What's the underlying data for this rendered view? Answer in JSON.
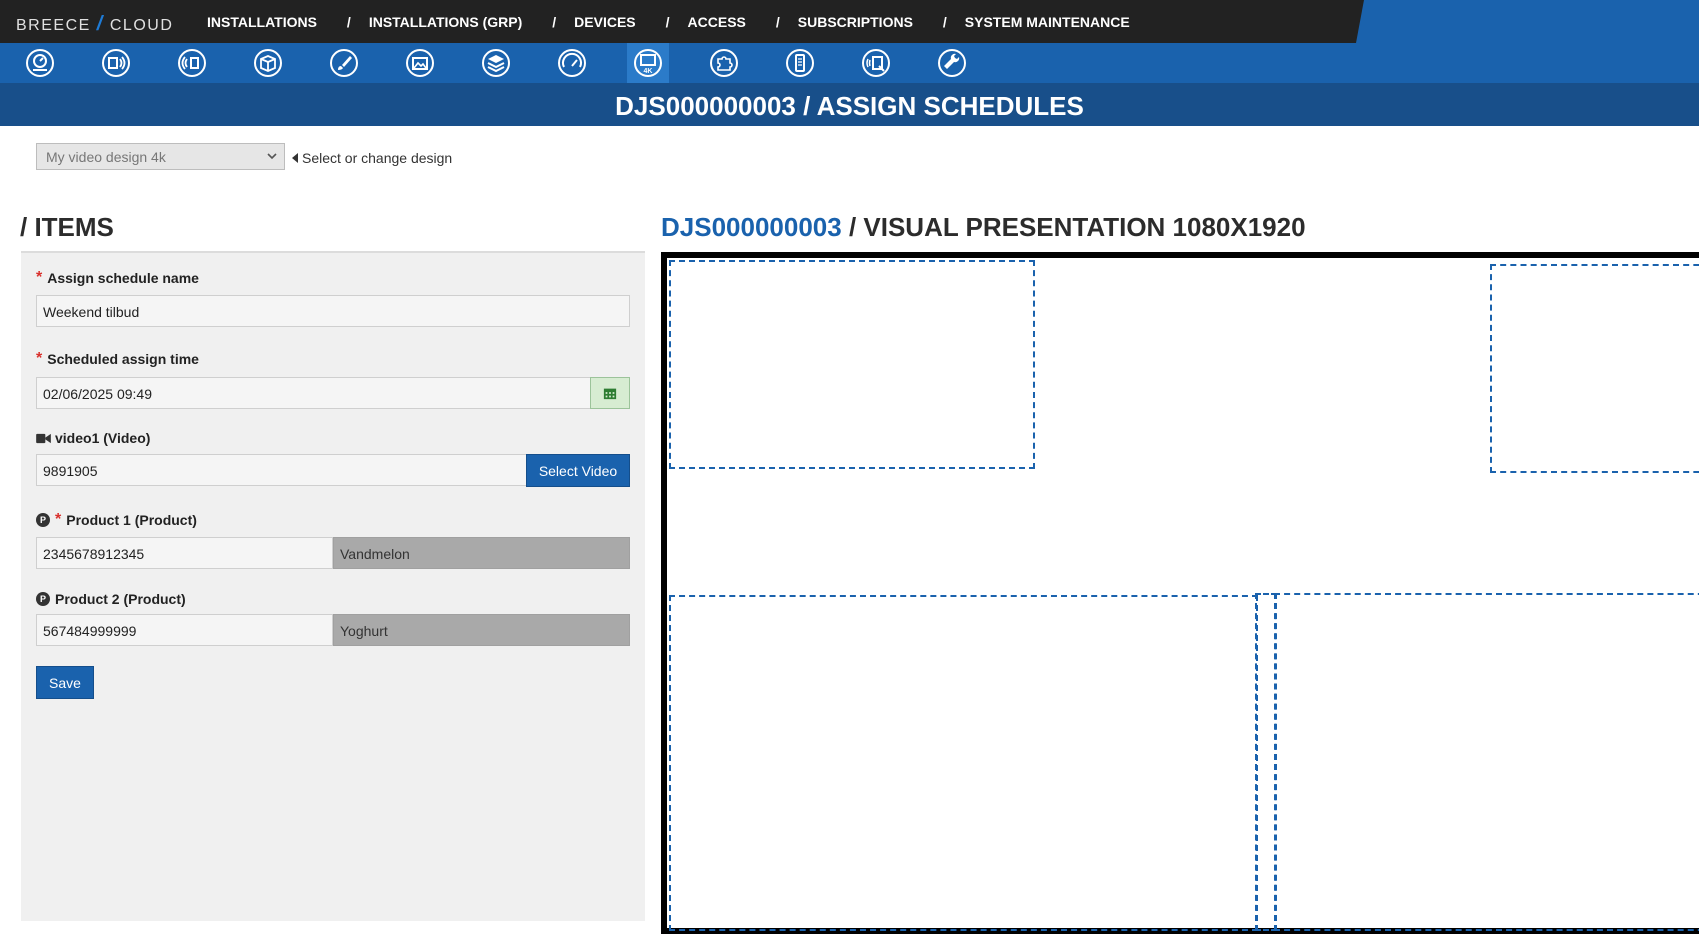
{
  "logo": {
    "left": "BREECE",
    "slash": "/",
    "right": "CLOUD"
  },
  "topnav": {
    "items": [
      "INSTALLATIONS",
      "INSTALLATIONS (GRP)",
      "DEVICES",
      "ACCESS",
      "SUBSCRIPTIONS",
      "SYSTEM MAINTENANCE"
    ],
    "separator": "/"
  },
  "page_title": "DJS000000003 / ASSIGN SCHEDULES",
  "design": {
    "selected": "My video design 4k",
    "hint": "Select or change design"
  },
  "items": {
    "heading": "/ ITEMS",
    "schedule_name": {
      "label": "Assign schedule name",
      "value": "Weekend tilbud"
    },
    "assign_time": {
      "label": "Scheduled assign time",
      "value": "02/06/2025 09:49"
    },
    "video": {
      "label": "video1 (Video)",
      "value": "9891905",
      "button": "Select Video"
    },
    "product1": {
      "label": "Product 1 (Product)",
      "code": "2345678912345",
      "name": "Vandmelon",
      "badge": "P"
    },
    "product2": {
      "label": "Product 2 (Product)",
      "code": "567484999999",
      "name": "Yoghurt",
      "badge": "P"
    },
    "save": "Save"
  },
  "presentation": {
    "id": "DJS000000003",
    "title": "/ VISUAL PRESENTATION 1080X1920"
  },
  "colors": {
    "primary": "#1a62ad",
    "topbar": "#222222",
    "titlebar": "#184f8a",
    "required": "#d9302c"
  },
  "icons": [
    "dashboard-icon",
    "signage-icon",
    "broadcast-icon",
    "package-icon",
    "brush-icon",
    "images-icon",
    "layers-icon",
    "gauge-icon",
    "monitor-4k-icon",
    "puzzle-icon",
    "mobile-icon",
    "device-settings-icon",
    "wrench-icon"
  ]
}
